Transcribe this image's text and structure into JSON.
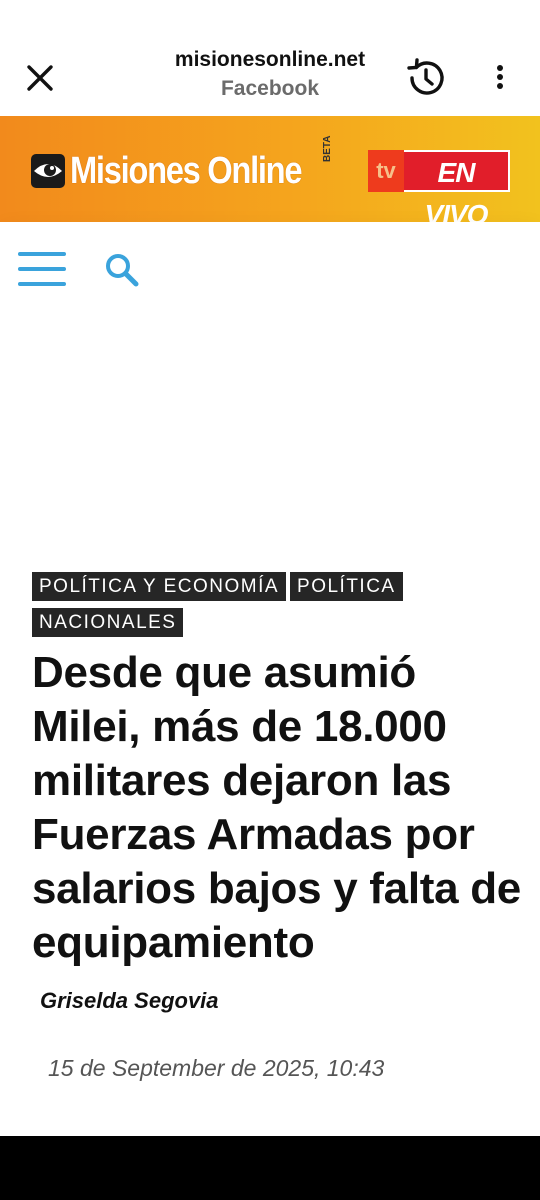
{
  "browser": {
    "domain": "misionesonline.net",
    "source": "Facebook",
    "close_icon": "close-icon",
    "history_icon": "history-icon",
    "more_icon": "more-vert-icon"
  },
  "brand": {
    "logo_text": "Misiones Online",
    "beta_label": "BETA",
    "live_tv": "tv",
    "live_label": "EN VIVO",
    "colors": {
      "header_orange": "#f28a1c",
      "live_red": "#e11e2a",
      "nav_blue": "#3aa3dc"
    }
  },
  "nav": {
    "menu_icon": "hamburger-menu-icon",
    "search_icon": "search-icon"
  },
  "article": {
    "tags": [
      "POLÍTICA Y ECONOMÍA",
      "POLÍTICA",
      "NACIONALES"
    ],
    "headline": "Desde que asumió Milei, más de 18.000 militares dejaron las Fuerzas Armadas por salarios bajos y falta de equipamiento",
    "author": "Griselda Segovia",
    "date": "15 de September de 2025, 10:43"
  }
}
